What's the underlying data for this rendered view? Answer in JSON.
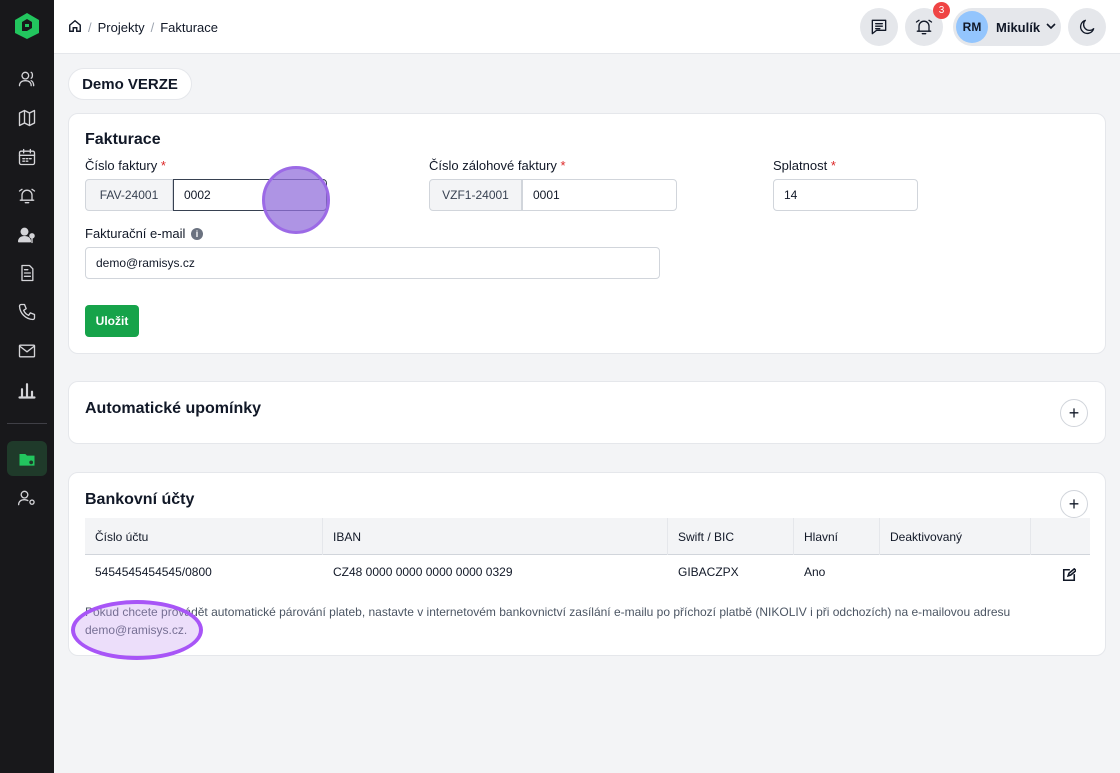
{
  "breadcrumb": {
    "items": [
      "Projekty",
      "Fakturace"
    ]
  },
  "notifications": {
    "count": "3"
  },
  "user": {
    "initials": "RM",
    "name": "Mikulík"
  },
  "project": {
    "name": "Demo VERZE"
  },
  "invoicing": {
    "title": "Fakturace",
    "invoice_number_label": "Číslo faktury",
    "invoice_prefix": "FAV-24001",
    "invoice_value": "0002",
    "advance_label": "Číslo zálohové faktury",
    "advance_prefix": "VZF1-24001",
    "advance_value": "0001",
    "due_label": "Splatnost",
    "due_value": "14",
    "email_label": "Fakturační e-mail",
    "email_value": "demo@ramisys.cz",
    "save_label": "Uložit",
    "required_mark": "*"
  },
  "reminders": {
    "title": "Automatické upomínky"
  },
  "bank": {
    "title": "Bankovní účty",
    "columns": [
      "Číslo účtu",
      "IBAN",
      "Swift / BIC",
      "Hlavní",
      "Deaktivovaný"
    ],
    "rows": [
      {
        "account": "5454545454545/0800",
        "iban": "CZ48 0000 0000 0000 0000 0329",
        "swift": "GIBACZPX",
        "main": "Ano",
        "deactivated": ""
      }
    ],
    "note": "Pokud chcete provádět automatické párování plateb, nastavte v internetovém bankovnictví zasílání e-mailu po příchozí platbě (NIKOLIV i při odchozích) na e-mailovou adresu demo@ramisys.cz."
  },
  "colors": {
    "accent": "#16a34a",
    "sidebar": "#18181b",
    "badge": "#ef4444",
    "highlight": "#a855f7"
  }
}
